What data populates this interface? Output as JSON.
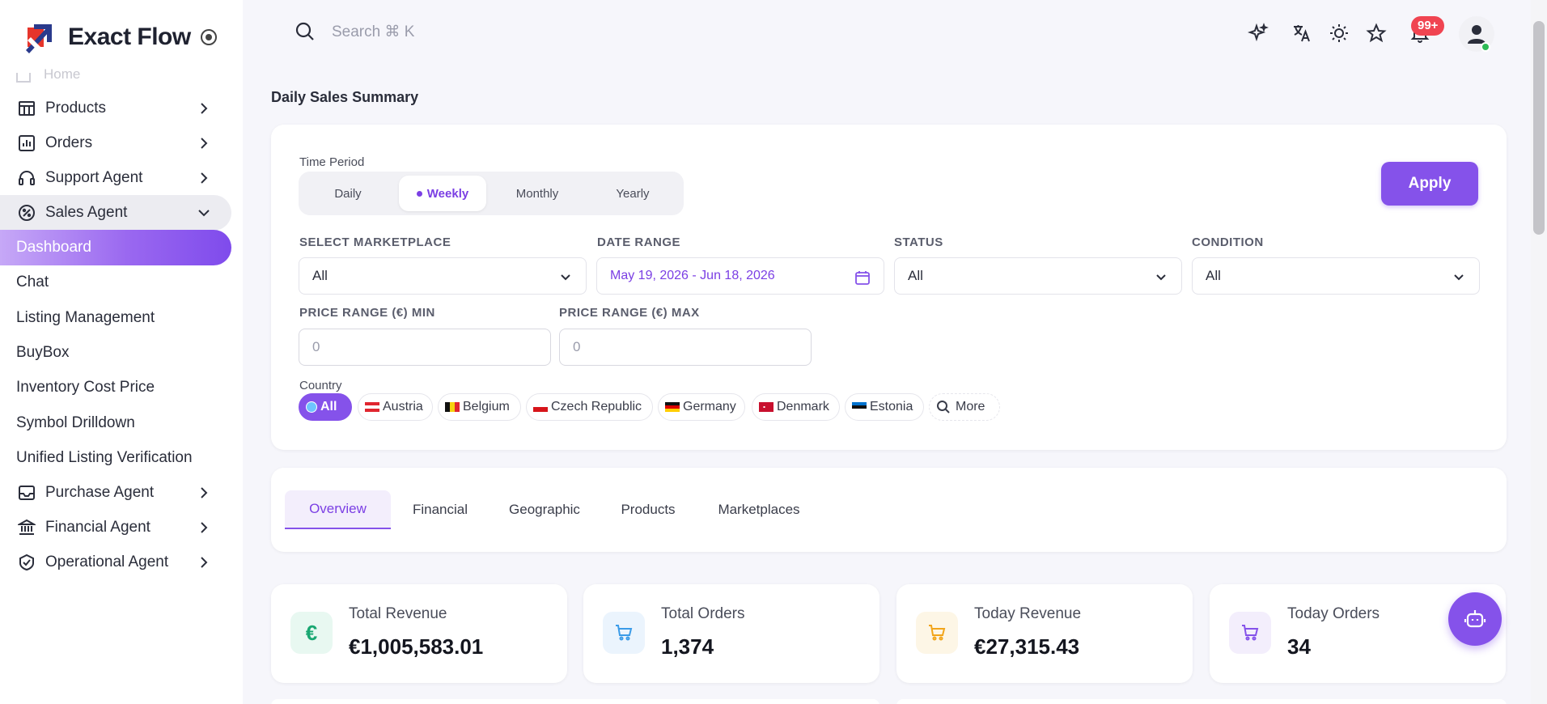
{
  "app": {
    "brand_name": "Exact Flow"
  },
  "header": {
    "search_placeholder": "Search ⌘ K",
    "notification_badge": "99+"
  },
  "sidebar": {
    "partial_item": "Home",
    "items": [
      {
        "label": "Products",
        "icon": "grid-icon",
        "chevron": "right"
      },
      {
        "label": "Orders",
        "icon": "chart-icon",
        "chevron": "right"
      },
      {
        "label": "Support Agent",
        "icon": "headset-icon",
        "chevron": "right"
      },
      {
        "label": "Sales Agent",
        "icon": "percent-badge-icon",
        "chevron": "down"
      },
      {
        "label": "Dashboard"
      },
      {
        "label": "Chat"
      },
      {
        "label": "Listing Management"
      },
      {
        "label": "BuyBox"
      },
      {
        "label": "Inventory Cost Price"
      },
      {
        "label": "Symbol Drilldown"
      },
      {
        "label": "Unified Listing Verification"
      },
      {
        "label": "Purchase Agent",
        "icon": "inbox-icon",
        "chevron": "right"
      },
      {
        "label": "Financial Agent",
        "icon": "bank-icon",
        "chevron": "right"
      },
      {
        "label": "Operational Agent",
        "icon": "handshake-icon",
        "chevron": "right"
      }
    ]
  },
  "main": {
    "page_title": "Daily Sales Summary",
    "filters": {
      "time_period_label": "Time Period",
      "periods": [
        "Daily",
        "Weekly",
        "Monthly",
        "Yearly"
      ],
      "selected_period": "Weekly",
      "apply_label": "Apply",
      "marketplace_label": "SELECT MARKETPLACE",
      "marketplace_value": "All",
      "date_range_label": "DATE RANGE",
      "date_range_value": "May 19, 2026 - Jun 18, 2026",
      "status_label": "STATUS",
      "status_value": "All",
      "condition_label": "CONDITION",
      "condition_value": "All",
      "price_min_label": "PRICE RANGE (€) MIN",
      "price_min_placeholder": "0",
      "price_max_label": "PRICE RANGE (€) MAX",
      "price_max_placeholder": "0",
      "country_label": "Country",
      "countries": [
        "All",
        "Austria",
        "Belgium",
        "Czech Republic",
        "Germany",
        "Denmark",
        "Estonia",
        "More"
      ]
    },
    "tabs": [
      "Overview",
      "Financial",
      "Geographic",
      "Products",
      "Marketplaces"
    ],
    "selected_tab": "Overview",
    "stats": [
      {
        "title": "Total Revenue",
        "value": "€1,005,583.01",
        "icon": "euro-icon",
        "color": "#1aa772"
      },
      {
        "title": "Total Orders",
        "value": "1,374",
        "icon": "cart-icon",
        "color": "#3b9be8"
      },
      {
        "title": "Today Revenue",
        "value": "€27,315.43",
        "icon": "cart-icon",
        "color": "#f2a51a"
      },
      {
        "title": "Today Orders",
        "value": "34",
        "icon": "cart-icon",
        "color": "#8552ea"
      }
    ]
  },
  "colors": {
    "accent": "#8552ea",
    "badge": "#f04451",
    "online": "#2dbb55"
  }
}
